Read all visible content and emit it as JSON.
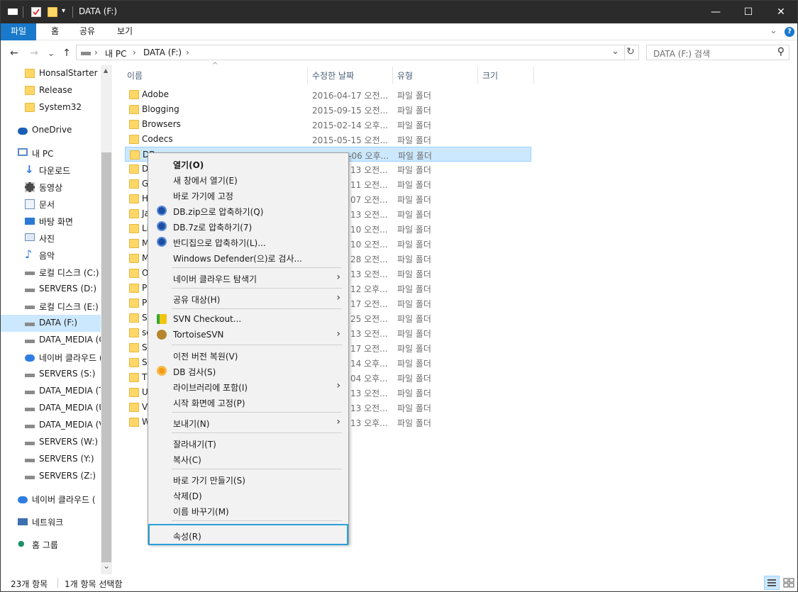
{
  "window": {
    "title": "DATA (F:)",
    "minimize": "—",
    "maximize": "☐",
    "close": "✕"
  },
  "ribbon": {
    "tabs": [
      "파일",
      "홈",
      "공유",
      "보기"
    ],
    "collapse": "⌄",
    "help": "?"
  },
  "address": {
    "back": "←",
    "forward": "→",
    "recent": "⌄",
    "up": "↑",
    "crumbs": [
      "내 PC",
      "DATA (F:)"
    ],
    "sep": "›",
    "dropdown": "⌄",
    "refresh": "↻"
  },
  "search": {
    "placeholder": "DATA (F:) 검색",
    "icon": "⚲"
  },
  "nav": {
    "items": [
      {
        "label": "HonsalStarter",
        "icon": "folder"
      },
      {
        "label": "Release",
        "icon": "folder"
      },
      {
        "label": "System32",
        "icon": "folder"
      },
      {
        "label": "OneDrive",
        "icon": "cloud"
      },
      {
        "label": "내 PC",
        "icon": "pc"
      },
      {
        "label": "다운로드",
        "icon": "download"
      },
      {
        "label": "동영상",
        "icon": "video"
      },
      {
        "label": "문서",
        "icon": "document"
      },
      {
        "label": "바탕 화면",
        "icon": "desktop"
      },
      {
        "label": "사진",
        "icon": "picture"
      },
      {
        "label": "음악",
        "icon": "music"
      },
      {
        "label": "로컬 디스크 (C:)",
        "icon": "drive"
      },
      {
        "label": "SERVERS (D:)",
        "icon": "drive"
      },
      {
        "label": "로컬 디스크 (E:)",
        "icon": "drive"
      },
      {
        "label": "DATA (F:)",
        "icon": "drive",
        "selected": true
      },
      {
        "label": "DATA_MEDIA (G:)",
        "icon": "drive"
      },
      {
        "label": "네이버 클라우드 (H:)",
        "icon": "cloud"
      },
      {
        "label": "SERVERS (S:)",
        "icon": "drive"
      },
      {
        "label": "DATA_MEDIA (T:)",
        "icon": "drive"
      },
      {
        "label": "DATA_MEDIA (U:)",
        "icon": "drive"
      },
      {
        "label": "DATA_MEDIA (V:)",
        "icon": "drive"
      },
      {
        "label": "SERVERS (W:)",
        "icon": "drive"
      },
      {
        "label": "SERVERS (Y:)",
        "icon": "drive"
      },
      {
        "label": "SERVERS (Z:)",
        "icon": "drive"
      },
      {
        "label": "네이버 클라우드 (",
        "icon": "cloud"
      },
      {
        "label": "네트워크",
        "icon": "network"
      },
      {
        "label": "홈 그룹",
        "icon": "homegroup"
      }
    ],
    "scroll_up": "▲",
    "scroll_down": "⌄"
  },
  "columns": {
    "name": "이름",
    "modified": "수정한 날짜",
    "type": "유형",
    "size": "크기",
    "sort_indicator": "^"
  },
  "files": [
    {
      "name": "Adobe",
      "date": "2016-04-17 오전...",
      "type": "파일 폴더"
    },
    {
      "name": "Blogging",
      "date": "2015-09-15 오전...",
      "type": "파일 폴더"
    },
    {
      "name": "Browsers",
      "date": "2015-02-14 오후...",
      "type": "파일 폴더"
    },
    {
      "name": "Codecs",
      "date": "2015-05-15 오전...",
      "type": "파일 폴더"
    },
    {
      "name": "DB",
      "date": "2015-09-06 오후...",
      "type": "파일 폴더",
      "selected": true
    },
    {
      "name": "D",
      "date": "13 오전...",
      "type": "파일 폴더"
    },
    {
      "name": "G",
      "date": "11 오전...",
      "type": "파일 폴더"
    },
    {
      "name": "H",
      "date": "07 오전...",
      "type": "파일 폴더"
    },
    {
      "name": "Ja",
      "date": "13 오전...",
      "type": "파일 폴더"
    },
    {
      "name": "Li",
      "date": "10 오전...",
      "type": "파일 폴더"
    },
    {
      "name": "M",
      "date": "10 오전...",
      "type": "파일 폴더"
    },
    {
      "name": "M",
      "date": "28 오전...",
      "type": "파일 폴더"
    },
    {
      "name": "O",
      "date": "13 오전...",
      "type": "파일 폴더"
    },
    {
      "name": "P",
      "date": "12 오후...",
      "type": "파일 폴더"
    },
    {
      "name": "P",
      "date": "17 오전...",
      "type": "파일 폴더"
    },
    {
      "name": "S",
      "date": "25 오전...",
      "type": "파일 폴더"
    },
    {
      "name": "so",
      "date": "13 오전...",
      "type": "파일 폴더"
    },
    {
      "name": "S",
      "date": "17 오전...",
      "type": "파일 폴더"
    },
    {
      "name": "S",
      "date": "14 오후...",
      "type": "파일 폴더"
    },
    {
      "name": "Tl",
      "date": "04 오후...",
      "type": "파일 폴더"
    },
    {
      "name": "U",
      "date": "13 오전...",
      "type": "파일 폴더"
    },
    {
      "name": "V",
      "date": "13 오전...",
      "type": "파일 폴더"
    },
    {
      "name": "W",
      "date": "13 오후...",
      "type": "파일 폴더"
    }
  ],
  "context_menu": {
    "items": [
      {
        "label": "열기(O)",
        "bold": true
      },
      {
        "label": "새 창에서 열기(E)"
      },
      {
        "label": "바로 가기에 고정"
      },
      {
        "label": "DB.zip으로 압축하기(Q)",
        "icon": "bandizip"
      },
      {
        "label": "DB.7z로 압축하기(7)",
        "icon": "bandizip"
      },
      {
        "label": "반디집으로 압축하기(L)...",
        "icon": "bandizip"
      },
      {
        "label": "Windows Defender(으)로 검사..."
      },
      {
        "sep": true
      },
      {
        "label": "네이버 클라우드 탐색기",
        "submenu": true
      },
      {
        "sep": true
      },
      {
        "label": "공유 대상(H)",
        "submenu": true
      },
      {
        "sep": true
      },
      {
        "label": "SVN Checkout...",
        "icon": "svn-checkout"
      },
      {
        "label": "TortoiseSVN",
        "icon": "tortoisesvn",
        "submenu": true
      },
      {
        "sep": true
      },
      {
        "label": "이전 버전 복원(V)"
      },
      {
        "label": "DB 검사(S)",
        "icon": "search-orange"
      },
      {
        "label": "라이브러리에 포함(I)",
        "submenu": true
      },
      {
        "label": "시작 화면에 고정(P)"
      },
      {
        "sep": true
      },
      {
        "label": "보내기(N)",
        "submenu": true
      },
      {
        "sep": true
      },
      {
        "label": "잘라내기(T)"
      },
      {
        "label": "복사(C)"
      },
      {
        "sep": true
      },
      {
        "label": "바로 가기 만들기(S)"
      },
      {
        "label": "삭제(D)"
      },
      {
        "label": "이름 바꾸기(M)"
      },
      {
        "sep": true
      },
      {
        "label": "속성(R)",
        "focused": true
      }
    ],
    "submenu_arrow": "›"
  },
  "status": {
    "count": "23개 항목",
    "selection": "1개 항목 선택함"
  },
  "colors": {
    "accent": "#1979ca",
    "selection": "#cce8ff",
    "focus_border": "#28a0d8",
    "folder": "#ffd766"
  }
}
